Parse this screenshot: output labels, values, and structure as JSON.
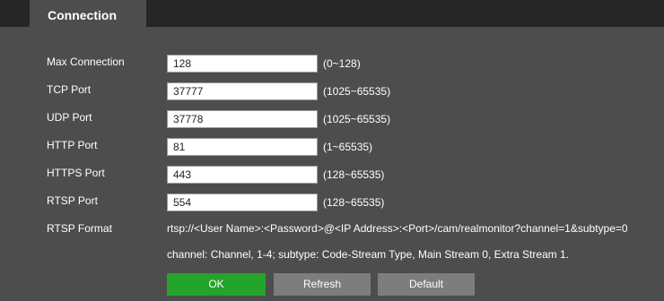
{
  "tab": {
    "label": "Connection"
  },
  "fields": [
    {
      "label": "Max Connection",
      "value": "128",
      "range": "(0~128)"
    },
    {
      "label": "TCP Port",
      "value": "37777",
      "range": "(1025~65535)"
    },
    {
      "label": "UDP Port",
      "value": "37778",
      "range": "(1025~65535)"
    },
    {
      "label": "HTTP Port",
      "value": "81",
      "range": "(1~65535)"
    },
    {
      "label": "HTTPS Port",
      "value": "443",
      "range": "(128~65535)"
    },
    {
      "label": "RTSP Port",
      "value": "554",
      "range": "(128~65535)"
    }
  ],
  "rtsp_format": {
    "label": "RTSP Format",
    "url": "rtsp://<User Name>:<Password>@<IP Address>:<Port>/cam/realmonitor?channel=1&subtype=0",
    "note": "channel: Channel, 1-4; subtype: Code-Stream Type, Main Stream 0, Extra Stream 1."
  },
  "buttons": {
    "ok": "OK",
    "refresh": "Refresh",
    "default": "Default"
  },
  "colors": {
    "background": "#4d4d4d",
    "top_strip": "#262626",
    "ok_button": "#24a42a",
    "secondary_button": "#7d7d7d"
  }
}
